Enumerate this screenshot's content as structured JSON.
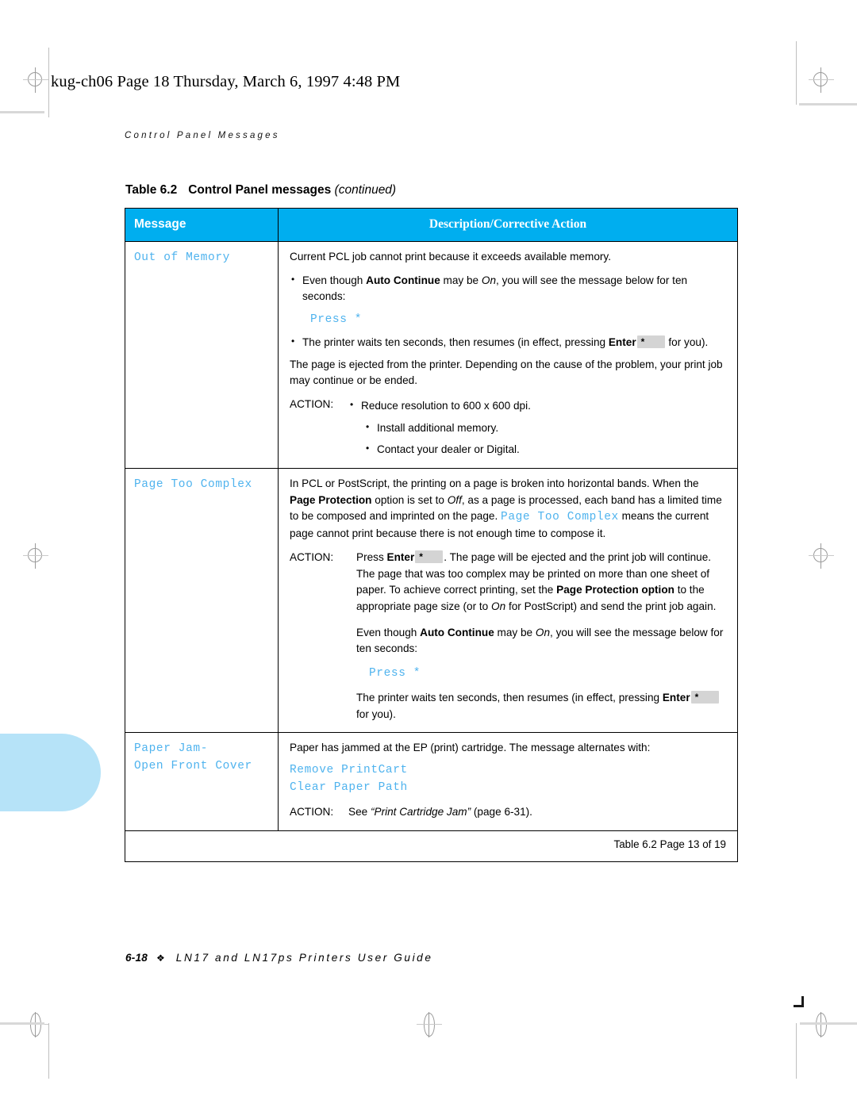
{
  "slug": "kug-ch06  Page 18  Thursday, March 6, 1997  4:48 PM",
  "running_head": "Control Panel Messages",
  "colors": {
    "header_fill": "#00AEEF",
    "mono_text": "#4FB3EE",
    "page_tab": "#b6e3f8"
  },
  "table_caption": {
    "number": "Table 6.2",
    "title": "Control Panel messages",
    "continued": "(continued)"
  },
  "table": {
    "headers": {
      "message": "Message",
      "description": "Description/Corrective Action"
    },
    "rows": [
      {
        "message": "Out of Memory",
        "intro": "Current PCL job cannot print because it exceeds available memory.",
        "bullets": [
          {
            "pre": "Even though ",
            "bold": "Auto Continue",
            "mid": " may be ",
            "italic": "On",
            "post": ", you will see the message below for ten seconds:"
          }
        ],
        "mono_after_bullet": "Press *",
        "bullet2": {
          "pre": "The printer waits ten seconds, then resumes (in effect, pressing ",
          "bold": "Enter",
          "key": "*",
          "post": " for you)."
        },
        "paragraph": "The page is ejected from the printer. Depending on the cause of the problem, your print job may continue or be ended.",
        "action_label": "ACTION:",
        "action_bullets": [
          "Reduce resolution to 600 x 600 dpi.",
          "Install additional memory.",
          "Contact your dealer or Digital."
        ]
      },
      {
        "message": "Page Too Complex",
        "para_parts": {
          "p1a": "In PCL or PostScript, the printing on a page is broken into horizontal bands. When the ",
          "b1": "Page Protection",
          "p1b": " option is set to ",
          "i1": "Off",
          "p1c": ", as a page is processed, each band has a limited time to be composed and imprinted on the page. ",
          "mono1": "Page Too Complex",
          "p1d": " means the current page cannot print because there is not enough time to compose it."
        },
        "action_label": "ACTION:",
        "action_parts": {
          "a1": "Press ",
          "b1": "Enter",
          "key": "*",
          "a2": ". The page will be ejected and the print job will continue. The page that was too complex may be printed on more than one sheet of paper. To achieve correct printing, set the ",
          "b2": "Page Protection option",
          "a3": " to the appropriate page size (or to ",
          "i1": "On",
          "a4": " for PostScript) and send the print job again."
        },
        "action_para2": {
          "p1": "Even though ",
          "b1": "Auto Continue",
          "p2": " may be ",
          "i1": "On",
          "p3": ", you will see the message below for ten seconds:"
        },
        "mono2": "Press *",
        "action_para3": {
          "p1": "The printer waits ten seconds, then resumes (in effect, pressing ",
          "b1": "Enter",
          "key": "*",
          "p2": " for you)."
        }
      },
      {
        "message_line1": "Paper Jam-",
        "message_line2": "Open Front Cover",
        "intro": "Paper has jammed at the EP (print) cartridge. The message alternates with:",
        "mono_lines": "Remove PrintCart\nClear Paper Path",
        "action_label": "ACTION:",
        "action_parts": {
          "a1": "See ",
          "q1": "“Print Cartridge Jam”",
          "a2": " (page 6-31)."
        }
      }
    ],
    "footer": "Table 6.2  Page 13 of 19"
  },
  "page_footer": {
    "folio": "6-18",
    "diamond": "❖",
    "book": "LN17 and LN17ps Printers User Guide"
  }
}
